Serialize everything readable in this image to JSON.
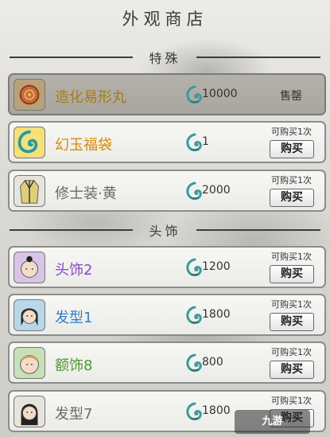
{
  "header": {
    "title": "外观商店"
  },
  "sections": [
    {
      "label": "特殊"
    },
    {
      "label": "头饰"
    }
  ],
  "items": [
    {
      "name": "造化易形丸",
      "price": "10000",
      "status": "售罄",
      "sold_out": true,
      "name_color": "#a87a1a",
      "icon": "pill-icon"
    },
    {
      "name": "幻玉福袋",
      "price": "1",
      "limit": "可购买1次",
      "buy_label": "购买",
      "name_color": "#d88a0a",
      "icon": "jade-pouch-icon"
    },
    {
      "name": "修士装·黄",
      "price": "2000",
      "limit": "可购买1次",
      "buy_label": "购买",
      "name_color": "#6a6a6a",
      "icon": "robe-icon"
    },
    {
      "name": "头饰2",
      "price": "1200",
      "limit": "可购买1次",
      "buy_label": "购买",
      "name_color": "#8a4ac8",
      "icon": "headwear-icon"
    },
    {
      "name": "发型1",
      "price": "1800",
      "limit": "可购买1次",
      "buy_label": "购买",
      "name_color": "#2f7fc8",
      "icon": "hairstyle-icon"
    },
    {
      "name": "额饰8",
      "price": "800",
      "limit": "可购买1次",
      "buy_label": "购买",
      "name_color": "#4e9a2e",
      "icon": "forehead-ornament-icon"
    },
    {
      "name": "发型7",
      "price": "1800",
      "limit": "可购买1次",
      "buy_label": "购买",
      "name_color": "#6a6a6a",
      "icon": "hairstyle-icon"
    }
  ],
  "currency": {
    "icon": "jade-currency-icon",
    "color": "#3aa0a0"
  },
  "watermark": {
    "text": "九游"
  }
}
